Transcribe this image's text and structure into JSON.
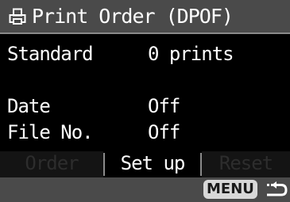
{
  "title": {
    "icon": "print-icon",
    "text": "Print Order (DPOF)"
  },
  "settings": [
    {
      "label": "Standard",
      "value": "0 prints"
    },
    {
      "label": "Date",
      "value": "Off"
    },
    {
      "label": "File No.",
      "value": "Off"
    }
  ],
  "tabs": [
    {
      "label": "Order",
      "enabled": false
    },
    {
      "label": "Set up",
      "enabled": true,
      "selected": true
    },
    {
      "label": "Reset",
      "enabled": false
    }
  ],
  "footer": {
    "menu_label": "MENU",
    "back_icon": "back-arrow-icon"
  }
}
